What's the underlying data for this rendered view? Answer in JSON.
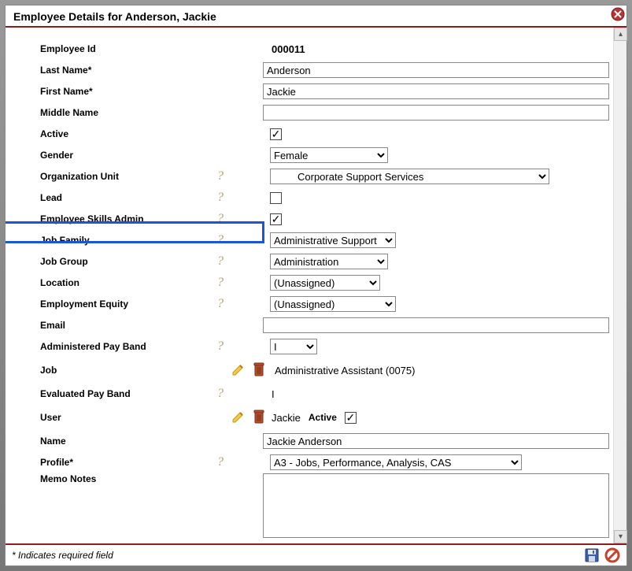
{
  "header": {
    "title": "Employee Details for Anderson, Jackie"
  },
  "fields": {
    "employee_id": {
      "label": "Employee Id",
      "value": "000011"
    },
    "last_name": {
      "label": "Last Name*",
      "value": "Anderson"
    },
    "first_name": {
      "label": "First Name*",
      "value": "Jackie"
    },
    "middle_name": {
      "label": "Middle Name",
      "value": ""
    },
    "active": {
      "label": "Active",
      "checked": true
    },
    "gender": {
      "label": "Gender",
      "value": "Female"
    },
    "org_unit": {
      "label": "Organization Unit",
      "value": "Corporate Support Services"
    },
    "lead": {
      "label": "Lead",
      "checked": false
    },
    "skills_admin": {
      "label": "Employee Skills Admin",
      "checked": true
    },
    "job_family": {
      "label": "Job Family",
      "value": "Administrative Support"
    },
    "job_group": {
      "label": "Job Group",
      "value": "Administration"
    },
    "location": {
      "label": "Location",
      "value": "(Unassigned)"
    },
    "emp_equity": {
      "label": "Employment Equity",
      "value": "(Unassigned)"
    },
    "email": {
      "label": "Email",
      "value": ""
    },
    "admin_pay_band": {
      "label": "Administered Pay Band",
      "value": "I"
    },
    "job": {
      "label": "Job",
      "value": "Administrative Assistant (0075)"
    },
    "eval_pay_band": {
      "label": "Evaluated Pay Band",
      "value": "I"
    },
    "user": {
      "label": "User",
      "value": "Jackie",
      "active_label": "Active",
      "active_checked": true
    },
    "name": {
      "label": "Name",
      "value": "Jackie Anderson"
    },
    "profile": {
      "label": "Profile*",
      "value": "A3 - Jobs, Performance, Analysis, CAS"
    },
    "memo_notes": {
      "label": "Memo Notes",
      "value": ""
    }
  },
  "footer": {
    "required_note": "* Indicates required field"
  },
  "icons": {
    "help": "?",
    "pencil": "edit-icon",
    "trash": "delete-icon",
    "close": "close-icon",
    "save": "save-icon",
    "cancel": "cancel-icon"
  }
}
